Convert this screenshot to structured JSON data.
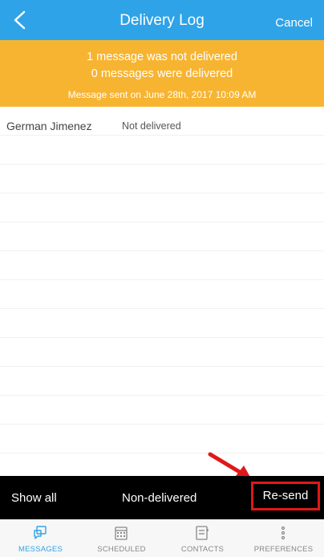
{
  "header": {
    "title": "Delivery Log",
    "cancel_label": "Cancel"
  },
  "banner": {
    "line1": "1 message was not delivered",
    "line2": "0 messages were delivered",
    "line3": "Message sent on June 28th, 2017 10:09 AM"
  },
  "rows": [
    {
      "name": "German Jimenez",
      "status": "Not delivered"
    }
  ],
  "filter_bar": {
    "show_all": "Show all",
    "non_delivered": "Non-delivered",
    "resend": "Re-send"
  },
  "tabs": [
    {
      "label": "MESSAGES",
      "icon": "messages-icon",
      "active": true
    },
    {
      "label": "SCHEDULED",
      "icon": "calendar-icon",
      "active": false
    },
    {
      "label": "CONTACTS",
      "icon": "contacts-icon",
      "active": false
    },
    {
      "label": "PREFERENCES",
      "icon": "preferences-icon",
      "active": false
    }
  ],
  "colors": {
    "header": "#2ea3e7",
    "banner": "#f7b431",
    "highlight": "#e01818",
    "filter_bar": "#000000"
  }
}
